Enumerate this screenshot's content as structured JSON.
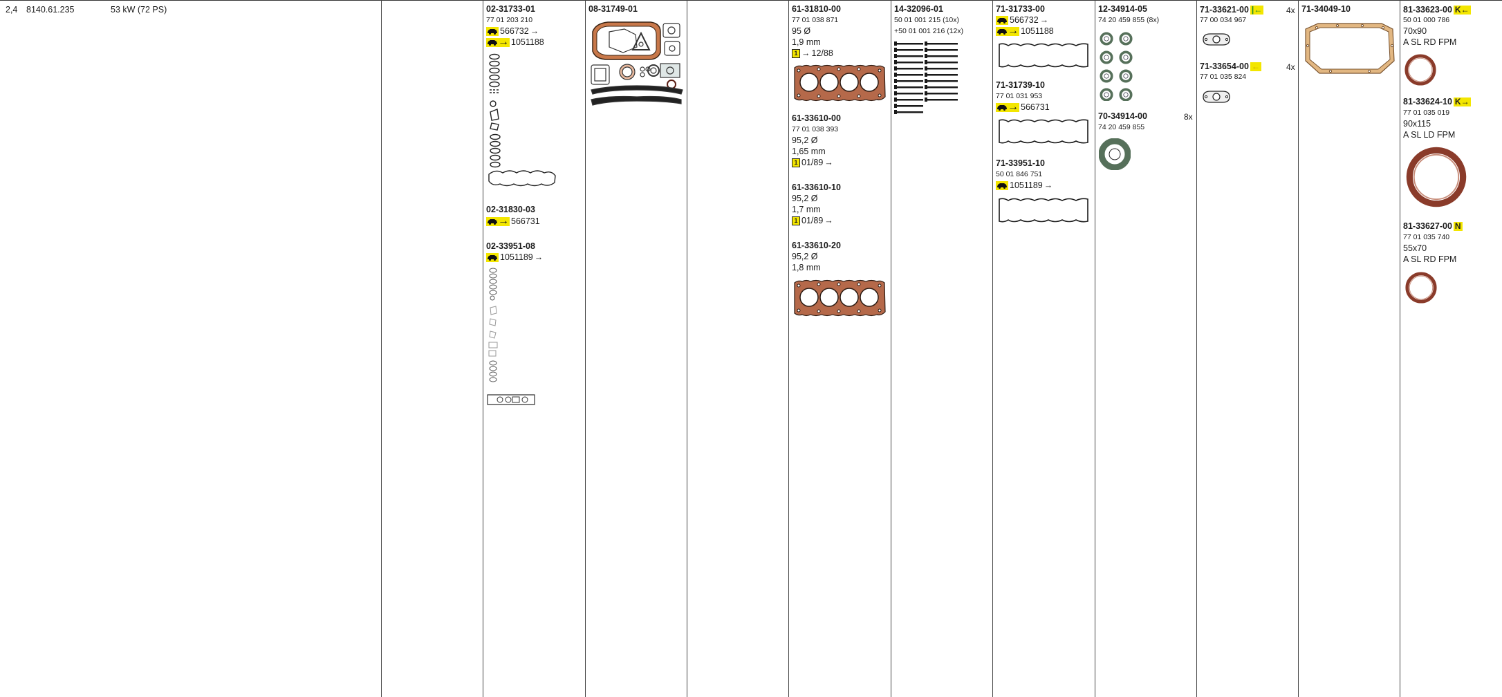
{
  "colors": {
    "yellow": "#f3e600",
    "gasket_brown": "#c8784a",
    "seal_gray": "#56705a",
    "cork": "#e2b782"
  },
  "header": {
    "displacement": "2,4",
    "engine_code": "8140.61.235",
    "power": "53 kW (72 PS)"
  },
  "set_a": {
    "part": "02-31733-01",
    "oe": "77 01 203 210",
    "from_no": "566732",
    "to_no": "1051188",
    "icon": "car-icon"
  },
  "set_b": {
    "part": "02-31830-03",
    "to_no": "566731"
  },
  "set_c": {
    "part": "02-33951-08",
    "from_no": "1051189"
  },
  "set_d": {
    "part": "08-31749-01"
  },
  "head": {
    "h1": {
      "part": "61-31810-00",
      "oe": "77 01 038 871",
      "bore": "95 Ø",
      "thickness": "1,9 mm",
      "badge": "1",
      "date": "12/88"
    },
    "h2": {
      "part": "61-33610-00",
      "oe": "77 01 038 393",
      "bore": "95,2 Ø",
      "thickness": "1,65 mm",
      "badge": "1",
      "date": "01/89"
    },
    "h3": {
      "part": "61-33610-10",
      "bore": "95,2 Ø",
      "thickness": "1,7 mm",
      "badge": "1",
      "date": "01/89"
    },
    "h4": {
      "part": "61-33610-20",
      "bore": "95,2 Ø",
      "thickness": "1,8 mm"
    }
  },
  "bolts": {
    "part": "14-32096-01",
    "oe1": "50 01 001 215 (10x)",
    "oe2": "+50 01 001 216 (12x)"
  },
  "valve_cover": {
    "v1": {
      "part": "71-31733-00",
      "from_no": "566732",
      "to_no": "1051188"
    },
    "v2": {
      "part": "71-31739-10",
      "oe": "77 01 031 953",
      "to_no": "566731"
    },
    "v3": {
      "part": "71-33951-10",
      "oe": "50 01 846 751",
      "from_no": "1051189"
    }
  },
  "stem_seals": {
    "s1": {
      "part": "12-34914-05",
      "oe": "74 20 459 855 (8x)"
    },
    "s2": {
      "part": "70-34914-00",
      "oe": "74 20 459 855",
      "qty": "8x"
    }
  },
  "manifold": {
    "m1": {
      "part": "71-33621-00",
      "oe": "77 00 034 967",
      "qty": "4x"
    },
    "m2": {
      "part": "71-33654-00",
      "oe": "77 01 035 824",
      "qty": "4x"
    }
  },
  "oil_pan": {
    "part": "71-34049-10"
  },
  "shaft_seals": {
    "r1": {
      "part": "81-33623-00",
      "flag": "K",
      "oe": "50 01 000 786",
      "size": "70x90",
      "spec": "A SL RD FPM"
    },
    "r2": {
      "part": "81-33624-10",
      "flag": "K",
      "oe": "77 01 035 019",
      "size": "90x115",
      "spec": "A SL LD FPM"
    },
    "r3": {
      "part": "81-33627-00",
      "flag": "N",
      "oe": "77 01 035 740",
      "size": "55x70",
      "spec": "A SL RD FPM"
    }
  }
}
